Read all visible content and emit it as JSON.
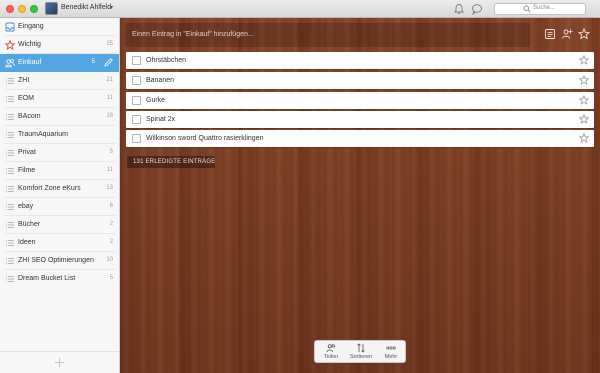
{
  "titlebar": {
    "user_name": "Benedikt Ahlfeld",
    "search_placeholder": "Suche..."
  },
  "sidebar": {
    "items": [
      {
        "label": "Eingang",
        "count": "",
        "icon": "inbox-icon"
      },
      {
        "label": "Wichtig",
        "count": "25",
        "icon": "star-icon"
      },
      {
        "label": "Einkauf",
        "count": "5",
        "icon": "people-icon",
        "active": true
      },
      {
        "label": "ZHI",
        "count": "21",
        "icon": "list-icon"
      },
      {
        "label": "EOM",
        "count": "11",
        "icon": "list-icon"
      },
      {
        "label": "BAcom",
        "count": "18",
        "icon": "list-icon"
      },
      {
        "label": "TraumAquarium",
        "count": "",
        "icon": "list-icon"
      },
      {
        "label": "Privat",
        "count": "5",
        "icon": "list-icon"
      },
      {
        "label": "Filme",
        "count": "11",
        "icon": "list-icon"
      },
      {
        "label": "Komfort Zone eKurs",
        "count": "13",
        "icon": "list-icon"
      },
      {
        "label": "ebay",
        "count": "6",
        "icon": "list-icon"
      },
      {
        "label": "Bücher",
        "count": "2",
        "icon": "list-icon"
      },
      {
        "label": "Ideen",
        "count": "2",
        "icon": "list-icon"
      },
      {
        "label": "ZHI SEO Optimierungen",
        "count": "10",
        "icon": "list-icon"
      },
      {
        "label": "Dream Bucket List",
        "count": "5",
        "icon": "list-icon"
      }
    ]
  },
  "main": {
    "add_placeholder": "Einen Eintrag in \"Einkauf\" hinzufügen...",
    "tasks": [
      {
        "label": "Ohrstäbchen"
      },
      {
        "label": "Bananen"
      },
      {
        "label": "Gurke"
      },
      {
        "label": "Spinat 2x"
      },
      {
        "label": "Wilkinson sword Quattro rasierklingen"
      }
    ],
    "completed_label": "131 ERLEDIGTE EINTRÄGE"
  },
  "bottom_bar": {
    "share_label": "Teilen",
    "sort_label": "Sortieren",
    "more_label": "Mehr"
  },
  "colors": {
    "accent": "#54a5e4",
    "wood": "#7a3c22"
  }
}
